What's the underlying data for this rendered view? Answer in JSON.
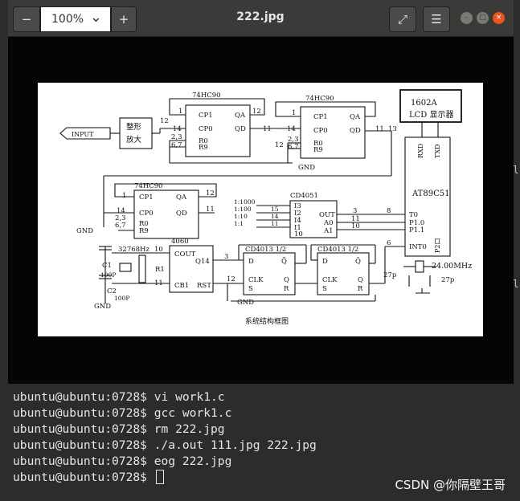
{
  "window": {
    "title": "222.jpg",
    "zoom": "100%",
    "zoom_out_icon": "−",
    "zoom_in_icon": "+",
    "dropdown_icon": "⌄",
    "fullscreen_icon": "⤢",
    "menu_icon": "☰",
    "minimize_icon": "–",
    "maximize_icon": "□",
    "close_icon": "×"
  },
  "schematic": {
    "caption": "系统结构框图",
    "input": "INPUT",
    "shaper": "整形",
    "amp": "放大",
    "u1": "74HC90",
    "u2": "74HC90",
    "u3": "74HC90",
    "cp1": "CP1",
    "cp0": "CP0",
    "r0": "R0",
    "r9": "R9",
    "qa": "QA",
    "qd": "QD",
    "pin1": "1",
    "pin14": "14",
    "pin23": "2,3",
    "pin67": "6,7",
    "pin11": "11",
    "pin12": "12",
    "t12": "12",
    "t11": "11",
    "t13": "13",
    "gnd": "GND",
    "lcd_model": "1602A",
    "lcd_label": "LCD 显示器",
    "rxd": "RXD",
    "txd": "TXD",
    "mcu": "AT89C51",
    "t0": "T0",
    "p10": "P1.0",
    "p11": "P1.1",
    "int0": "INT0",
    "p2": "P2口",
    "cd4051": "CD4051",
    "r1000": "1:1000",
    "r100": "1:100",
    "r10": "1:10",
    "r1": "1:1",
    "i4": "I4",
    "i3": "I3",
    "i2": "I2",
    "i1": "I1",
    "n15": "15",
    "n13": "13",
    "n14": "14",
    "n11": "11",
    "n10": "10",
    "out": "OUT",
    "a0": "A0",
    "a1": "A1",
    "n3": "3",
    "n8": "8",
    "n6": "6",
    "xtal": "32768Hz",
    "c1": "C1",
    "c1v": "100P",
    "c2": "C2",
    "c2v": "100P",
    "r1lbl": "R1",
    "cd4060": "4060",
    "cout": "COUT",
    "q14": "Q14",
    "cb1": "CB1",
    "rst": "RST",
    "ff1": "CD4013 1/2",
    "ff2": "CD4013 1/2",
    "d": "D",
    "q": "Q",
    "qbar": "Q̄",
    "clk": "CLK",
    "s": "S",
    "r": "R",
    "freq": "24.00MHz",
    "c27a": "27p",
    "c27b": "27p"
  },
  "terminal": {
    "lines": [
      "ubuntu@ubuntu:0728$ vi work1.c",
      "ubuntu@ubuntu:0728$ gcc work1.c",
      "ubuntu@ubuntu:0728$ rm 222.jpg",
      "ubuntu@ubuntu:0728$ ./a.out 111.jpg 222.jpg",
      "ubuntu@ubuntu:0728$ eog 222.jpg"
    ],
    "prompt": "ubuntu@ubuntu:0728$ ",
    "right_fragment1": "l",
    "right_fragment2": "l"
  },
  "watermark": "CSDN @你隔壁王哥"
}
